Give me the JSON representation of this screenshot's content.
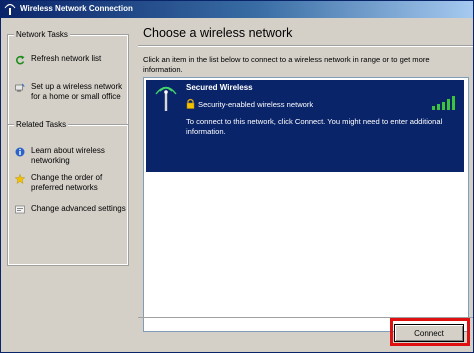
{
  "window": {
    "title": "Wireless Network Connection",
    "icon": "wireless-network-icon"
  },
  "sidebar": {
    "network_tasks": {
      "title": "Network Tasks",
      "items": [
        {
          "label": "Refresh network list",
          "icon": "refresh-icon"
        },
        {
          "label": "Set up a wireless network for a home or small office",
          "icon": "setup-network-icon"
        }
      ]
    },
    "related_tasks": {
      "title": "Related Tasks",
      "items": [
        {
          "label": "Learn about wireless networking",
          "icon": "info-icon"
        },
        {
          "label": "Change the order of preferred networks",
          "icon": "star-icon"
        },
        {
          "label": "Change advanced settings",
          "icon": "settings-icon"
        }
      ]
    }
  },
  "main": {
    "heading": "Choose a wireless network",
    "instruction": "Click an item in the list below to connect to a wireless network in range or to get more information.",
    "networks": [
      {
        "name": "Secured Wireless",
        "security": "Security-enabled wireless network",
        "description": "To connect to this network, click Connect. You might need to enter additional information.",
        "signal_strength": "5 of 5 bars",
        "selected": true
      }
    ],
    "connect_label": "Connect"
  },
  "colors": {
    "titlebar_start": "#0a246a",
    "titlebar_end": "#a6caf0",
    "selection": "#0a246a",
    "signal": "#3cc43c",
    "highlight": "#e01010",
    "panel": "#d4d0c8"
  }
}
